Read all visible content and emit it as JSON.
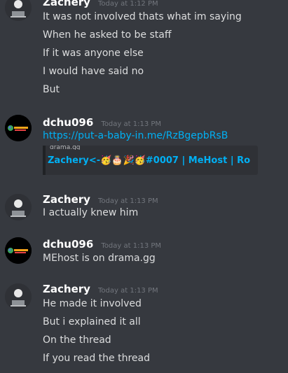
{
  "groups": [
    {
      "author": "Zachery",
      "timestamp": "Today at 1:12 PM",
      "lines": [
        "It was not involved thats what im saying",
        "When he asked to be staff",
        "If it was anyone else",
        "I would have said no",
        "But"
      ]
    },
    {
      "author": "dchu096",
      "timestamp": "Today at 1:13 PM",
      "link": "https://put-a-baby-in.me/RzBgepbRsB",
      "embed": {
        "title": "Zachery<-🥳🎂🎉🥳#0007 | MeHost | Ro",
        "top_text": "drama.gg",
        "bottom_text": ""
      }
    },
    {
      "author": "Zachery",
      "timestamp": "Today at 1:13 PM",
      "lines": [
        "I actually knew him"
      ]
    },
    {
      "author": "dchu096",
      "timestamp": "Today at 1:13 PM",
      "lines": [
        "MEhost is on drama.gg"
      ]
    },
    {
      "author": "Zachery",
      "timestamp": "Today at 1:13 PM",
      "lines": [
        "He made it involved",
        "But i explained it all",
        "On the thread",
        "If you read the thread"
      ]
    }
  ],
  "colors": {
    "background": "#36393f",
    "link": "#00b0f4",
    "author": "#ffffff",
    "timestamp": "#72767d",
    "text": "#dcddde"
  },
  "icons": {
    "zachery_avatar": "laptop-user-avatar-icon",
    "dchu_avatar": "colorful-logo-avatar-icon"
  }
}
